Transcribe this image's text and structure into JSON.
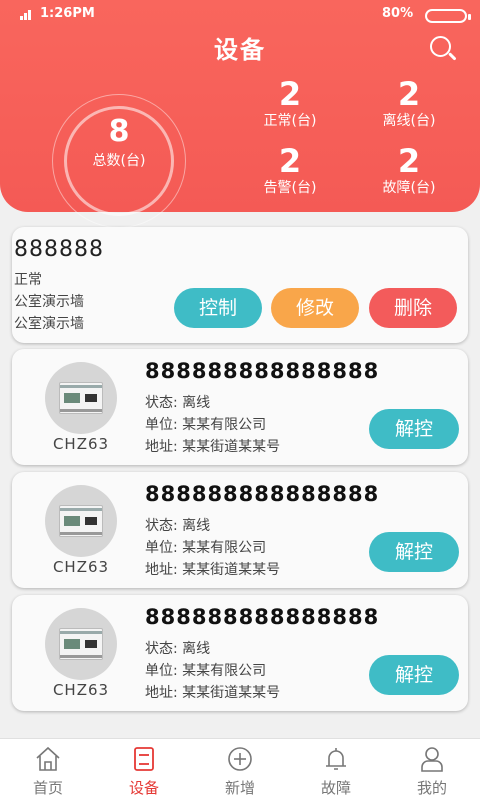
{
  "status_bar": {
    "time": "1:26PM",
    "battery": "80%"
  },
  "header": {
    "title": "设备",
    "total": {
      "value": "8",
      "label": "总数(台)"
    },
    "stats": [
      {
        "value": "2",
        "label": "正常(台)"
      },
      {
        "value": "2",
        "label": "离线(台)"
      },
      {
        "value": "2",
        "label": "告警(台)"
      },
      {
        "value": "2",
        "label": "故障(台)"
      }
    ]
  },
  "top_card": {
    "code": "888888",
    "status": "正常",
    "line2": "公室演示墙",
    "line3": "公室演示墙",
    "buttons": {
      "control": "控制",
      "edit": "修改",
      "delete": "删除"
    }
  },
  "devices": [
    {
      "model": "CHZ63",
      "serial": "888888888888888",
      "status": "状态: 离线",
      "unit": "单位: 某某有限公司",
      "address": "地址: 某某街道某某号",
      "action": "解控"
    },
    {
      "model": "CHZ63",
      "serial": "888888888888888",
      "status": "状态: 离线",
      "unit": "单位: 某某有限公司",
      "address": "地址: 某某街道某某号",
      "action": "解控"
    },
    {
      "model": "CHZ63",
      "serial": "888888888888888",
      "status": "状态: 离线",
      "unit": "单位: 某某有限公司",
      "address": "地址: 某某街道某某号",
      "action": "解控"
    }
  ],
  "tabs": [
    {
      "label": "首页",
      "icon": "home-icon"
    },
    {
      "label": "设备",
      "icon": "device-icon",
      "active": true
    },
    {
      "label": "新增",
      "icon": "add-icon"
    },
    {
      "label": "故障",
      "icon": "bell-icon"
    },
    {
      "label": "我的",
      "icon": "user-icon"
    }
  ],
  "colors": {
    "primary": "#f45a55",
    "teal": "#3fbcc6",
    "orange": "#f9a64a",
    "red": "#f35b5b",
    "active_tab": "#e53935"
  }
}
